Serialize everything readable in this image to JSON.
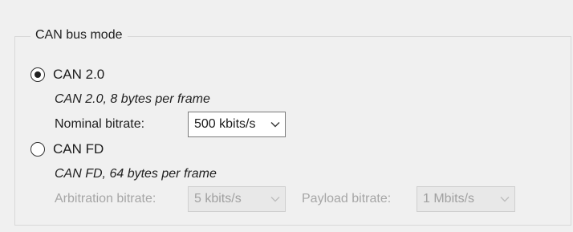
{
  "group": {
    "title": "CAN bus mode"
  },
  "can20": {
    "label": "CAN 2.0",
    "selected": true,
    "description": "CAN 2.0, 8 bytes per frame",
    "nominal_label": "Nominal bitrate:",
    "nominal_value": "500 kbits/s"
  },
  "canfd": {
    "label": "CAN FD",
    "selected": false,
    "description": "CAN FD, 64 bytes per frame",
    "arbitration_label": "Arbitration bitrate:",
    "arbitration_value": "5 kbits/s",
    "payload_label": "Payload bitrate:",
    "payload_value": "1 Mbits/s"
  },
  "colors": {
    "background": "#f0f0f0",
    "disabled_text": "#a6a6a6",
    "border": "#d8d8d8"
  }
}
